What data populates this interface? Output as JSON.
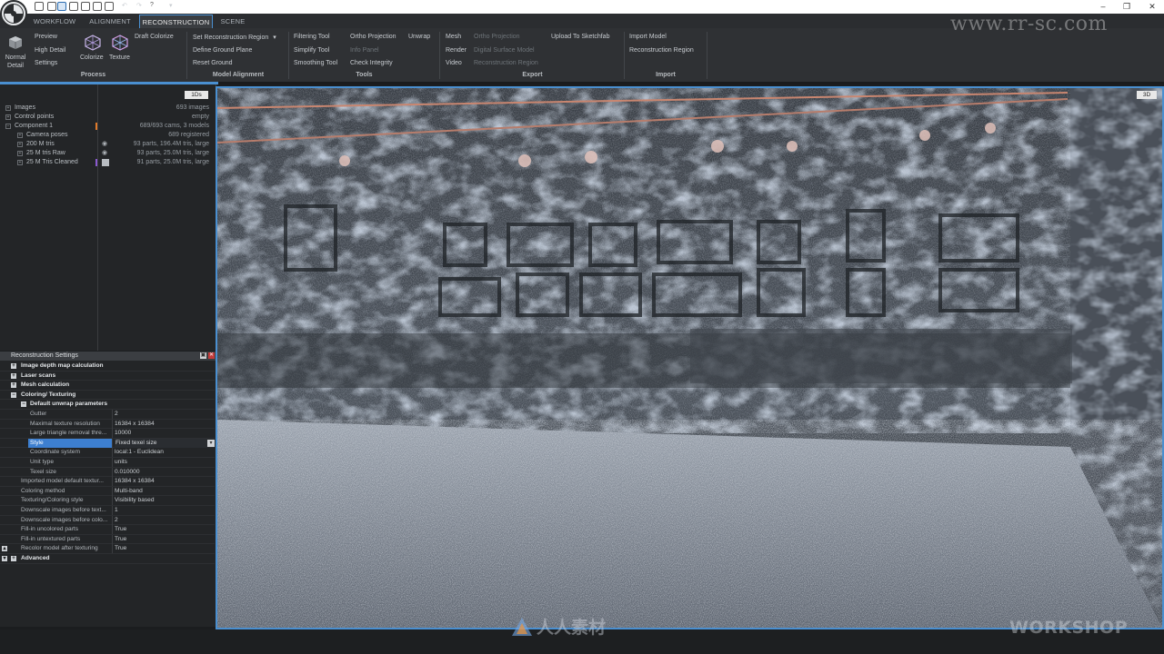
{
  "tabs": [
    {
      "label": "WORKFLOW",
      "active": false
    },
    {
      "label": "ALIGNMENT",
      "active": false
    },
    {
      "label": "RECONSTRUCTION",
      "active": true
    },
    {
      "label": "SCENE",
      "active": false
    }
  ],
  "ribbon": {
    "process": {
      "group_label": "Process",
      "normal_detail_line1": "Normal",
      "normal_detail_line2": "Detail",
      "preview": "Preview",
      "high_detail": "High Detail",
      "settings": "Settings",
      "colorize": "Colorize",
      "texture": "Texture",
      "draft_colorize": "Draft Colorize"
    },
    "model_alignment": {
      "group_label": "Model Alignment",
      "set_reconstruction_region": "Set Reconstruction Region",
      "define_ground_plane": "Define Ground Plane",
      "reset_ground": "Reset Ground"
    },
    "tools": {
      "group_label": "Tools",
      "filtering_tool": "Filtering Tool",
      "simplify_tool": "Simplify Tool",
      "smoothing_tool": "Smoothing Tool",
      "ortho_projection": "Ortho Projection",
      "unwrap": "Unwrap",
      "info_panel": "Info Panel",
      "check_integrity": "Check Integrity"
    },
    "export": {
      "group_label": "Export",
      "mesh": "Mesh",
      "render": "Render",
      "video": "Video",
      "ortho_projection": "Ortho Projection",
      "digital_surface_model": "Digital Surface Model",
      "reconstruction_region": "Reconstruction Region",
      "upload_sketchfab": "Upload To Sketchfab"
    },
    "import": {
      "group_label": "Import",
      "import_model": "Import Model",
      "reconstruction_region": "Reconstruction Region"
    }
  },
  "scene_panel": {
    "tag": "1Ds",
    "rows": [
      {
        "name": "Images",
        "value": "693 images",
        "indent": 0
      },
      {
        "name": "Control points",
        "value": "empty",
        "indent": 0
      },
      {
        "name": "Component 1",
        "value": "689/693 cams, 3 models",
        "indent": 0
      },
      {
        "name": "Camera poses",
        "value": "689 registered",
        "indent": 1
      },
      {
        "name": "200 M tris",
        "value": "93 parts, 196.4M tris, large",
        "indent": 1
      },
      {
        "name": "25 M tris Raw",
        "value": "93 parts, 25.0M tris, large",
        "indent": 1
      },
      {
        "name": "25 M Tris Cleaned",
        "value": "91 parts, 25.0M tris, large",
        "indent": 1
      }
    ]
  },
  "settings_panel": {
    "title": "Reconstruction Settings",
    "rows": [
      {
        "name": "Image depth map calculation",
        "value": "",
        "kind": "section"
      },
      {
        "name": "Laser scans",
        "value": "",
        "kind": "section"
      },
      {
        "name": "Mesh calculation",
        "value": "",
        "kind": "section"
      },
      {
        "name": "Coloring/ Texturing",
        "value": "",
        "kind": "section"
      },
      {
        "name": "Default unwrap parameters",
        "value": "",
        "kind": "subsection"
      },
      {
        "name": "Gutter",
        "value": "2",
        "kind": "sub"
      },
      {
        "name": "Maximal texture resolution",
        "value": "16384 x 16384",
        "kind": "sub"
      },
      {
        "name": "Large triangle removal thre...",
        "value": "10000",
        "kind": "sub"
      },
      {
        "name": "Style",
        "value": "Fixed texel size",
        "kind": "selected"
      },
      {
        "name": "Coordinate system",
        "value": "local:1 - Euclidean",
        "kind": "sub"
      },
      {
        "name": "Unit type",
        "value": "units",
        "kind": "sub"
      },
      {
        "name": "Texel size",
        "value": "0.010000",
        "kind": "sub"
      },
      {
        "name": "Imported model default textur...",
        "value": "16384 x 16384",
        "kind": "item"
      },
      {
        "name": "Coloring method",
        "value": "Multi-band",
        "kind": "item"
      },
      {
        "name": "Texturing/Coloring style",
        "value": "Visibility based",
        "kind": "item"
      },
      {
        "name": "Downscale images before text...",
        "value": "1",
        "kind": "item"
      },
      {
        "name": "Downscale images before colo...",
        "value": "2",
        "kind": "item"
      },
      {
        "name": "Fill-in uncolored parts",
        "value": "True",
        "kind": "item"
      },
      {
        "name": "Fill-in untextured parts",
        "value": "True",
        "kind": "item"
      },
      {
        "name": "Recolor model after texturing",
        "value": "True",
        "kind": "item"
      },
      {
        "name": "Advanced",
        "value": "",
        "kind": "section"
      }
    ]
  },
  "viewport": {
    "tag": "3D"
  },
  "watermarks": {
    "url": "www.rr-sc.com",
    "bottom_brand": "人人素材",
    "workshop": "WORKSHOP"
  },
  "colors": {
    "accent": "#4a8fd0",
    "selection": "#3d7fd0",
    "marker_orange": "#e07a2a",
    "marker_purple": "#8a5ad0"
  },
  "icons": [
    "app-logo-icon",
    "eye-icon",
    "plus-icon",
    "chevron-down-icon",
    "close-icon"
  ]
}
